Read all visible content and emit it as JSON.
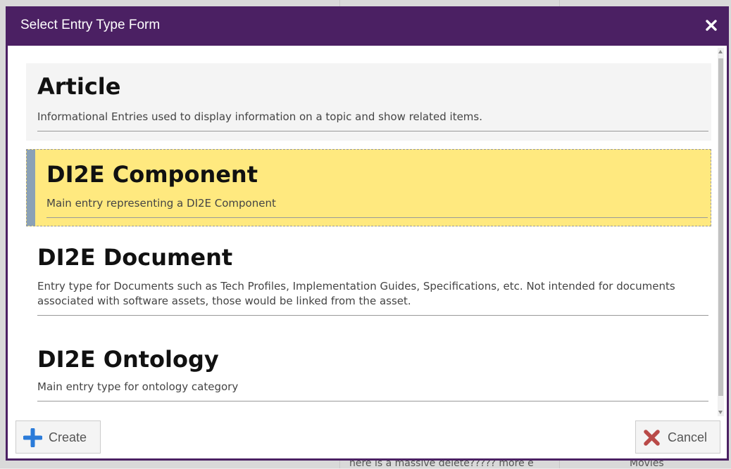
{
  "modal": {
    "title": "Select Entry Type Form",
    "entries": [
      {
        "title": "Article",
        "description": "Informational Entries used to display information on a topic and show related items.",
        "selected": false
      },
      {
        "title": "DI2E Component",
        "description": "Main entry representing a DI2E Component",
        "selected": true
      },
      {
        "title": "DI2E Document",
        "description": "Entry type for Documents such as Tech Profiles, Implementation Guides, Specifications, etc.  Not intended for documents associated with software assets, those would be linked from the asset.",
        "selected": false
      },
      {
        "title": "DI2E Ontology",
        "description": "Main entry type for ontology category",
        "selected": false
      }
    ],
    "buttons": {
      "create_label": "Create",
      "cancel_label": "Cancel"
    }
  },
  "background": {
    "bottom_left_text": "here is a massive delete????? more e",
    "bottom_right_text": "Movies"
  },
  "colors": {
    "header": "#4b2063",
    "selected_bg": "#ffe97f",
    "selected_accent": "#8aa1b6",
    "create_icon": "#2b7bd9",
    "cancel_icon": "#b94a48"
  },
  "icons": {
    "close": "close-icon",
    "create": "plus-icon",
    "cancel": "x-icon"
  }
}
